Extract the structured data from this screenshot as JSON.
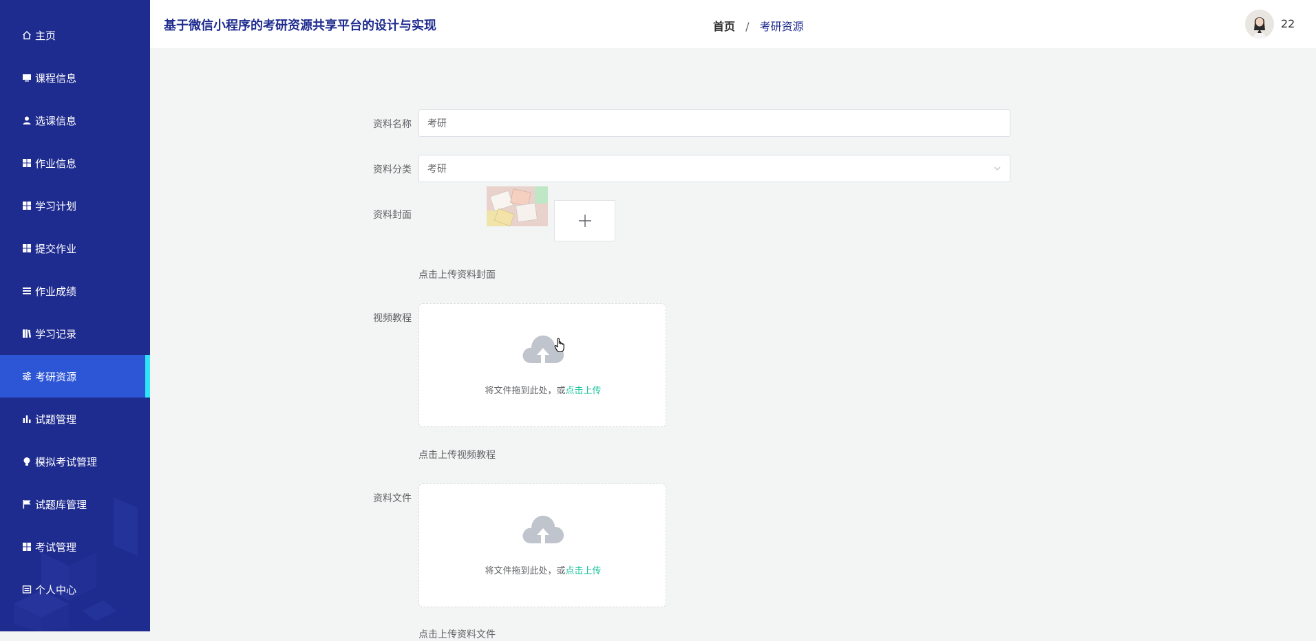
{
  "header": {
    "app_title": "基于微信小程序的考研资源共享平台的设计与实现",
    "breadcrumb_home": "首页",
    "breadcrumb_separator": "/",
    "breadcrumb_current": "考研资源",
    "username": "22"
  },
  "sidebar": {
    "items": [
      {
        "label": "主页",
        "icon": "home-icon"
      },
      {
        "label": "课程信息",
        "icon": "monitor-icon"
      },
      {
        "label": "选课信息",
        "icon": "user-icon"
      },
      {
        "label": "作业信息",
        "icon": "grid-icon"
      },
      {
        "label": "学习计划",
        "icon": "grid-icon"
      },
      {
        "label": "提交作业",
        "icon": "grid-icon"
      },
      {
        "label": "作业成绩",
        "icon": "list-icon"
      },
      {
        "label": "学习记录",
        "icon": "book-icon"
      },
      {
        "label": "考研资源",
        "icon": "sliders-icon",
        "active": true
      },
      {
        "label": "试题管理",
        "icon": "bar-chart-icon"
      },
      {
        "label": "模拟考试管理",
        "icon": "bulb-icon"
      },
      {
        "label": "试题库管理",
        "icon": "flag-icon"
      },
      {
        "label": "考试管理",
        "icon": "grid-icon"
      },
      {
        "label": "个人中心",
        "icon": "card-icon"
      }
    ],
    "colors": {
      "background": "#1f2c8f",
      "active": "#2d56d6",
      "active_indicator": "#30e3f5"
    }
  },
  "form": {
    "name_label": "资料名称",
    "name_value": "考研",
    "category_label": "资料分类",
    "category_value": "考研",
    "cover_label": "资料封面",
    "cover_tip": "点击上传资料封面",
    "video_label": "视频教程",
    "video_upload_text": "将文件拖到此处，或",
    "video_upload_link": "点击上传",
    "video_tip": "点击上传视频教程",
    "file_label": "资料文件",
    "file_upload_text": "将文件拖到此处，或",
    "file_upload_link": "点击上传",
    "file_tip": "点击上传资料文件"
  },
  "colors": {
    "accent": "#13c29a",
    "title": "#1f2c8f"
  }
}
